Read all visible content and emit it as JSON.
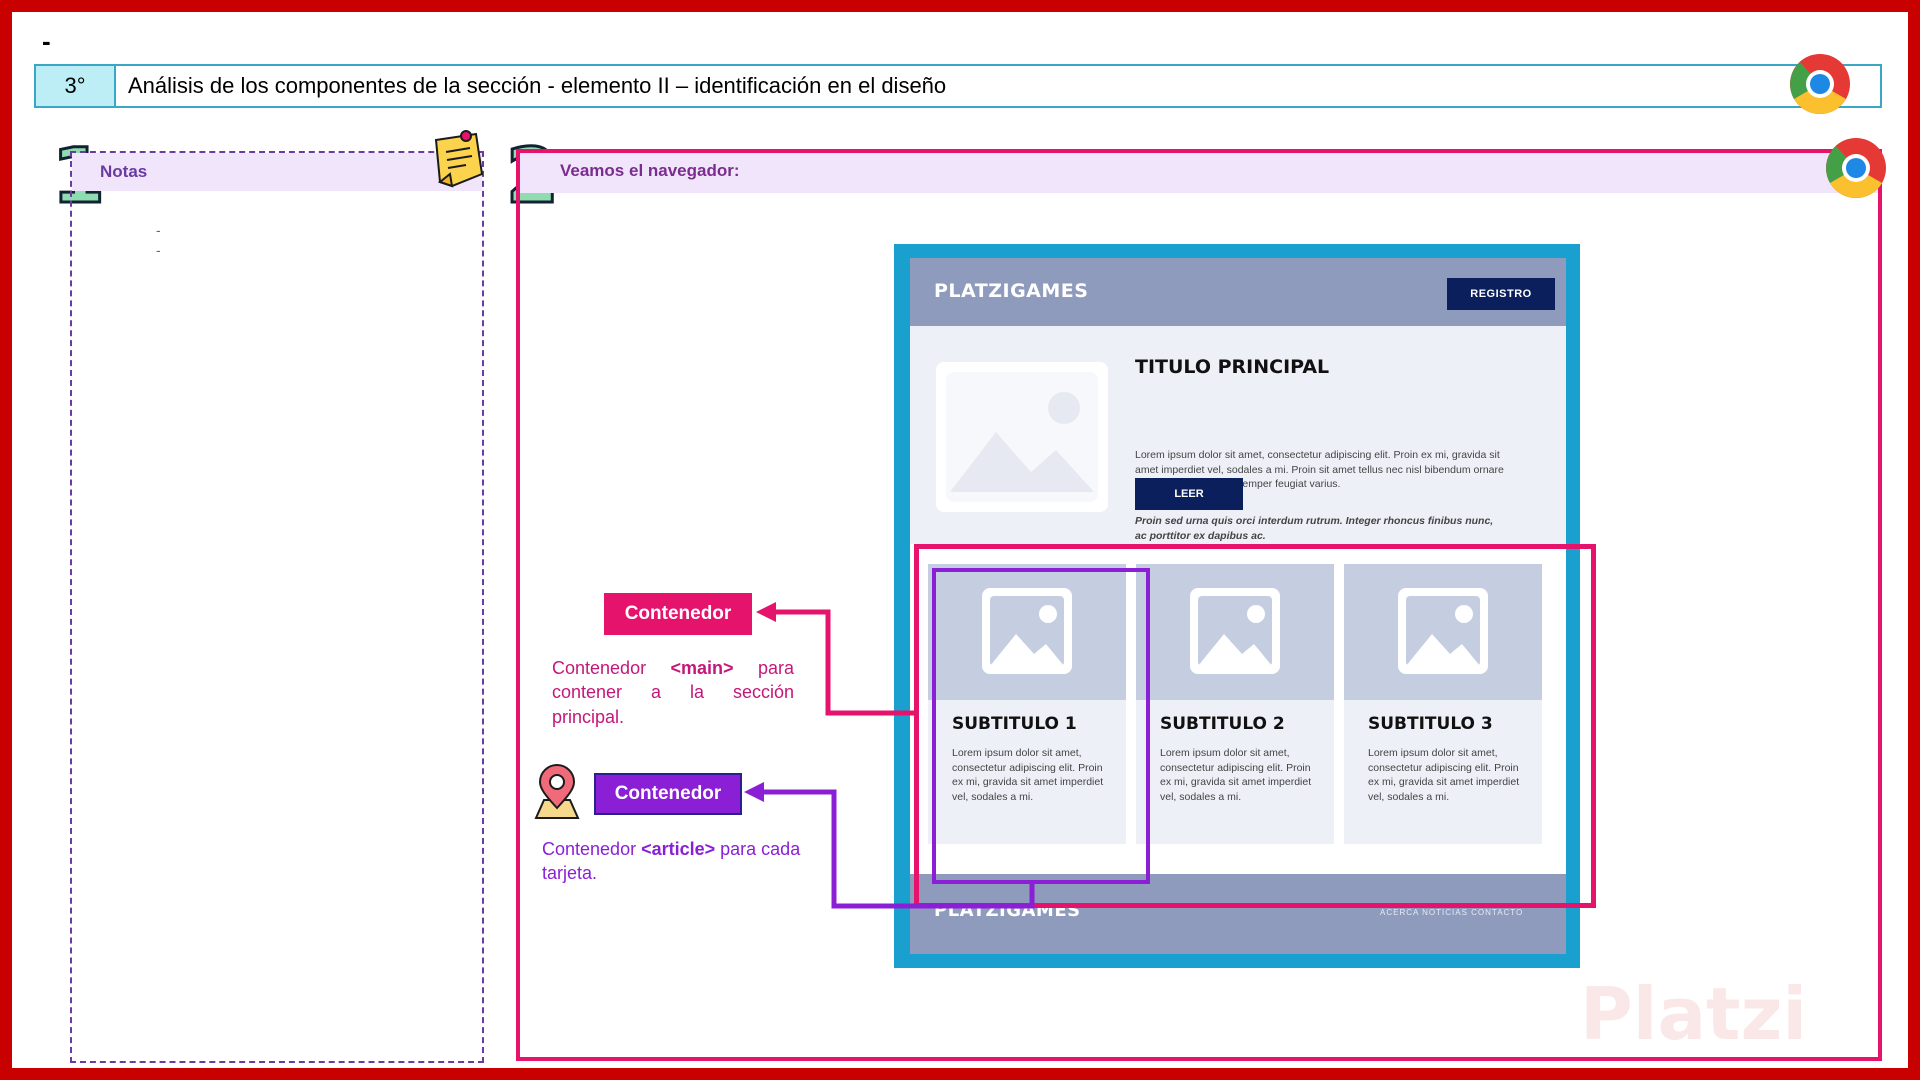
{
  "slide": {
    "top_dash": "-",
    "step_number": "3°",
    "title": "Análisis de los componentes de la sección   - elemento II – identificación en el diseño"
  },
  "notes": {
    "number": "1",
    "title": "Notas",
    "bullets": [
      "-",
      "-"
    ]
  },
  "browser": {
    "number": "2",
    "title": "Veamos el navegador:"
  },
  "mockup": {
    "brand": "PLATZIGAMES",
    "register_button": "REGISTRO",
    "hero_title": "TITULO PRINCIPAL",
    "hero_text": "Lorem ipsum dolor sit amet, consectetur adipiscing elit. Proin ex mi, gravida sit amet imperdiet vel, sodales a mi. Proin sit amet tellus nec nisl bibendum ornare nec at augue. Integer semper feugiat varius.",
    "hero_text_italic": "Proin sed urna quis orci interdum rutrum. Integer rhoncus finibus nunc, ac porttitor ex dapibus ac.",
    "read_button": "LEER",
    "cards": [
      {
        "title": "SUBTITULO 1",
        "text": "Lorem ipsum dolor sit amet, consectetur adipiscing elit. Proin ex mi, gravida sit amet imperdiet vel, sodales a mi."
      },
      {
        "title": "SUBTITULO 2",
        "text": "Lorem ipsum dolor sit amet, consectetur adipiscing elit. Proin ex mi, gravida sit amet imperdiet vel, sodales a mi."
      },
      {
        "title": "SUBTITULO 3",
        "text": "Lorem ipsum dolor sit amet, consectetur adipiscing elit. Proin ex mi, gravida sit amet imperdiet vel, sodales a mi."
      }
    ],
    "footer_brand": "PLATZIGAMES",
    "footer_links": "ACERCA   NOTICIAS   CONTACTO"
  },
  "callouts": {
    "main": {
      "label": "Contenedor",
      "desc_before": "Contenedor ",
      "desc_tag": "<main>",
      "desc_after": " para contener a la sección principal."
    },
    "article": {
      "label": "Contenedor",
      "desc_before": "Contenedor ",
      "desc_tag": "<article>",
      "desc_after": " para cada tarjeta."
    }
  },
  "watermark": "Platzi",
  "colors": {
    "frame": "#c80000",
    "main_outline": "#e6136d",
    "article_outline": "#8b1fd6",
    "header_accent": "#3aa7c4"
  },
  "icons": [
    "chrome-icon",
    "sticky-note-icon",
    "map-pin-icon"
  ]
}
